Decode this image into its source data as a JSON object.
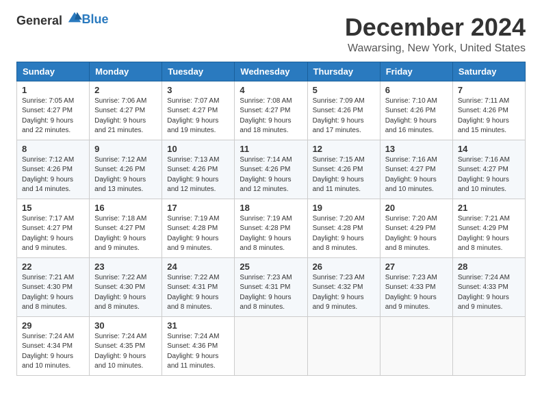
{
  "header": {
    "logo_general": "General",
    "logo_blue": "Blue",
    "month": "December 2024",
    "location": "Wawarsing, New York, United States"
  },
  "weekdays": [
    "Sunday",
    "Monday",
    "Tuesday",
    "Wednesday",
    "Thursday",
    "Friday",
    "Saturday"
  ],
  "weeks": [
    [
      {
        "day": "1",
        "sunrise": "Sunrise: 7:05 AM",
        "sunset": "Sunset: 4:27 PM",
        "daylight": "Daylight: 9 hours and 22 minutes."
      },
      {
        "day": "2",
        "sunrise": "Sunrise: 7:06 AM",
        "sunset": "Sunset: 4:27 PM",
        "daylight": "Daylight: 9 hours and 21 minutes."
      },
      {
        "day": "3",
        "sunrise": "Sunrise: 7:07 AM",
        "sunset": "Sunset: 4:27 PM",
        "daylight": "Daylight: 9 hours and 19 minutes."
      },
      {
        "day": "4",
        "sunrise": "Sunrise: 7:08 AM",
        "sunset": "Sunset: 4:27 PM",
        "daylight": "Daylight: 9 hours and 18 minutes."
      },
      {
        "day": "5",
        "sunrise": "Sunrise: 7:09 AM",
        "sunset": "Sunset: 4:26 PM",
        "daylight": "Daylight: 9 hours and 17 minutes."
      },
      {
        "day": "6",
        "sunrise": "Sunrise: 7:10 AM",
        "sunset": "Sunset: 4:26 PM",
        "daylight": "Daylight: 9 hours and 16 minutes."
      },
      {
        "day": "7",
        "sunrise": "Sunrise: 7:11 AM",
        "sunset": "Sunset: 4:26 PM",
        "daylight": "Daylight: 9 hours and 15 minutes."
      }
    ],
    [
      {
        "day": "8",
        "sunrise": "Sunrise: 7:12 AM",
        "sunset": "Sunset: 4:26 PM",
        "daylight": "Daylight: 9 hours and 14 minutes."
      },
      {
        "day": "9",
        "sunrise": "Sunrise: 7:12 AM",
        "sunset": "Sunset: 4:26 PM",
        "daylight": "Daylight: 9 hours and 13 minutes."
      },
      {
        "day": "10",
        "sunrise": "Sunrise: 7:13 AM",
        "sunset": "Sunset: 4:26 PM",
        "daylight": "Daylight: 9 hours and 12 minutes."
      },
      {
        "day": "11",
        "sunrise": "Sunrise: 7:14 AM",
        "sunset": "Sunset: 4:26 PM",
        "daylight": "Daylight: 9 hours and 12 minutes."
      },
      {
        "day": "12",
        "sunrise": "Sunrise: 7:15 AM",
        "sunset": "Sunset: 4:26 PM",
        "daylight": "Daylight: 9 hours and 11 minutes."
      },
      {
        "day": "13",
        "sunrise": "Sunrise: 7:16 AM",
        "sunset": "Sunset: 4:27 PM",
        "daylight": "Daylight: 9 hours and 10 minutes."
      },
      {
        "day": "14",
        "sunrise": "Sunrise: 7:16 AM",
        "sunset": "Sunset: 4:27 PM",
        "daylight": "Daylight: 9 hours and 10 minutes."
      }
    ],
    [
      {
        "day": "15",
        "sunrise": "Sunrise: 7:17 AM",
        "sunset": "Sunset: 4:27 PM",
        "daylight": "Daylight: 9 hours and 9 minutes."
      },
      {
        "day": "16",
        "sunrise": "Sunrise: 7:18 AM",
        "sunset": "Sunset: 4:27 PM",
        "daylight": "Daylight: 9 hours and 9 minutes."
      },
      {
        "day": "17",
        "sunrise": "Sunrise: 7:19 AM",
        "sunset": "Sunset: 4:28 PM",
        "daylight": "Daylight: 9 hours and 9 minutes."
      },
      {
        "day": "18",
        "sunrise": "Sunrise: 7:19 AM",
        "sunset": "Sunset: 4:28 PM",
        "daylight": "Daylight: 9 hours and 8 minutes."
      },
      {
        "day": "19",
        "sunrise": "Sunrise: 7:20 AM",
        "sunset": "Sunset: 4:28 PM",
        "daylight": "Daylight: 9 hours and 8 minutes."
      },
      {
        "day": "20",
        "sunrise": "Sunrise: 7:20 AM",
        "sunset": "Sunset: 4:29 PM",
        "daylight": "Daylight: 9 hours and 8 minutes."
      },
      {
        "day": "21",
        "sunrise": "Sunrise: 7:21 AM",
        "sunset": "Sunset: 4:29 PM",
        "daylight": "Daylight: 9 hours and 8 minutes."
      }
    ],
    [
      {
        "day": "22",
        "sunrise": "Sunrise: 7:21 AM",
        "sunset": "Sunset: 4:30 PM",
        "daylight": "Daylight: 9 hours and 8 minutes."
      },
      {
        "day": "23",
        "sunrise": "Sunrise: 7:22 AM",
        "sunset": "Sunset: 4:30 PM",
        "daylight": "Daylight: 9 hours and 8 minutes."
      },
      {
        "day": "24",
        "sunrise": "Sunrise: 7:22 AM",
        "sunset": "Sunset: 4:31 PM",
        "daylight": "Daylight: 9 hours and 8 minutes."
      },
      {
        "day": "25",
        "sunrise": "Sunrise: 7:23 AM",
        "sunset": "Sunset: 4:31 PM",
        "daylight": "Daylight: 9 hours and 8 minutes."
      },
      {
        "day": "26",
        "sunrise": "Sunrise: 7:23 AM",
        "sunset": "Sunset: 4:32 PM",
        "daylight": "Daylight: 9 hours and 9 minutes."
      },
      {
        "day": "27",
        "sunrise": "Sunrise: 7:23 AM",
        "sunset": "Sunset: 4:33 PM",
        "daylight": "Daylight: 9 hours and 9 minutes."
      },
      {
        "day": "28",
        "sunrise": "Sunrise: 7:24 AM",
        "sunset": "Sunset: 4:33 PM",
        "daylight": "Daylight: 9 hours and 9 minutes."
      }
    ],
    [
      {
        "day": "29",
        "sunrise": "Sunrise: 7:24 AM",
        "sunset": "Sunset: 4:34 PM",
        "daylight": "Daylight: 9 hours and 10 minutes."
      },
      {
        "day": "30",
        "sunrise": "Sunrise: 7:24 AM",
        "sunset": "Sunset: 4:35 PM",
        "daylight": "Daylight: 9 hours and 10 minutes."
      },
      {
        "day": "31",
        "sunrise": "Sunrise: 7:24 AM",
        "sunset": "Sunset: 4:36 PM",
        "daylight": "Daylight: 9 hours and 11 minutes."
      },
      null,
      null,
      null,
      null
    ]
  ]
}
